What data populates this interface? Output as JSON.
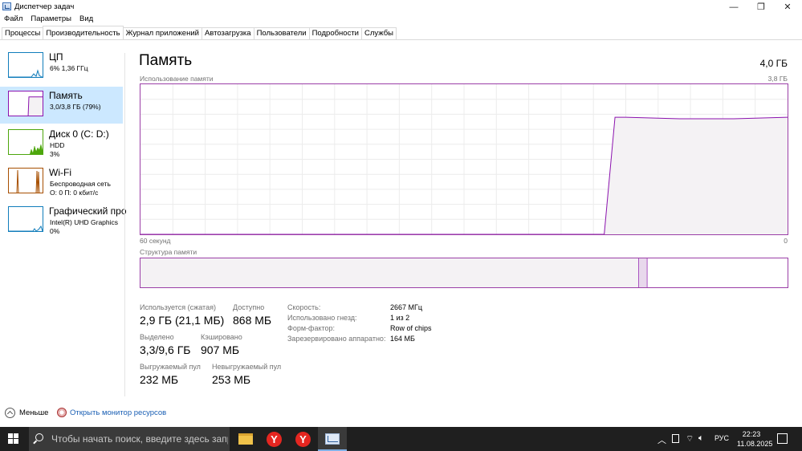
{
  "window": {
    "title": "Диспетчер задач"
  },
  "menu": [
    "Файл",
    "Параметры",
    "Вид"
  ],
  "tabs": [
    "Процессы",
    "Производительность",
    "Журнал приложений",
    "Автозагрузка",
    "Пользователи",
    "Подробности",
    "Службы"
  ],
  "active_tab": "Производительность",
  "sidebar": [
    {
      "title": "ЦП",
      "line1": "6% 1,36 ГГц",
      "line2": "",
      "color": "#117dbb"
    },
    {
      "title": "Память",
      "line1": "3,0/3,8 ГБ (79%)",
      "line2": "",
      "color": "#8b12ae",
      "memory_fraction": 0.79
    },
    {
      "title": "Диск 0 (C: D:)",
      "line1": "HDD",
      "line2": "3%",
      "color": "#4da60c"
    },
    {
      "title": "Wi-Fi",
      "line1": "Беспроводная сеть",
      "line2": "О: 0 П: 0 кбит/с",
      "color": "#a74f01"
    },
    {
      "title": "Графический про",
      "line1": "Intel(R) UHD Graphics",
      "line2": "0%",
      "color": "#117dbb"
    }
  ],
  "main": {
    "title": "Память",
    "total": "4,0 ГБ",
    "usage_label": "Использование памяти",
    "usage_max": "3,8 ГБ",
    "time_left": "60 секунд",
    "time_right": "0",
    "structure_label": "Структура памяти",
    "usage_graph": {
      "x": [
        60,
        55,
        50,
        45,
        40,
        35,
        30,
        25,
        20,
        17,
        16,
        15,
        10,
        5,
        0
      ],
      "y_fraction": [
        0,
        0,
        0,
        0,
        0,
        0,
        0,
        0,
        0,
        0,
        0.78,
        0.78,
        0.77,
        0.77,
        0.78
      ]
    },
    "structure": {
      "in_use_fraction": 0.77,
      "modified_fraction": 0.013
    },
    "stats": {
      "in_use_label": "Используется (сжатая)",
      "in_use_value": "2,9 ГБ (21,1 МБ)",
      "available_label": "Доступно",
      "available_value": "868 МБ",
      "committed_label": "Выделено",
      "committed_value": "3,3/9,6 ГБ",
      "cached_label": "Кэшировано",
      "cached_value": "907 МБ",
      "paged_label": "Выгружаемый пул",
      "paged_value": "232 МБ",
      "nonpaged_label": "Невыгружаемый пул",
      "nonpaged_value": "253 МБ"
    },
    "details": [
      {
        "label": "Скорость:",
        "value": "2667 МГц"
      },
      {
        "label": "Использовано гнезд:",
        "value": "1 из 2"
      },
      {
        "label": "Форм-фактор:",
        "value": "Row of chips"
      },
      {
        "label": "Зарезервировано аппаратно:",
        "value": "164 МБ"
      }
    ]
  },
  "footer": {
    "fewer": "Меньше",
    "monitor": "Открыть монитор ресурсов"
  },
  "taskbar": {
    "search_placeholder": "Чтобы начать поиск, введите здесь запрос",
    "lang": "РУС",
    "time": "22:23",
    "date": "11.08.2025"
  },
  "colors": {
    "memory": "#8b12ae",
    "accent": "#cce8ff"
  }
}
